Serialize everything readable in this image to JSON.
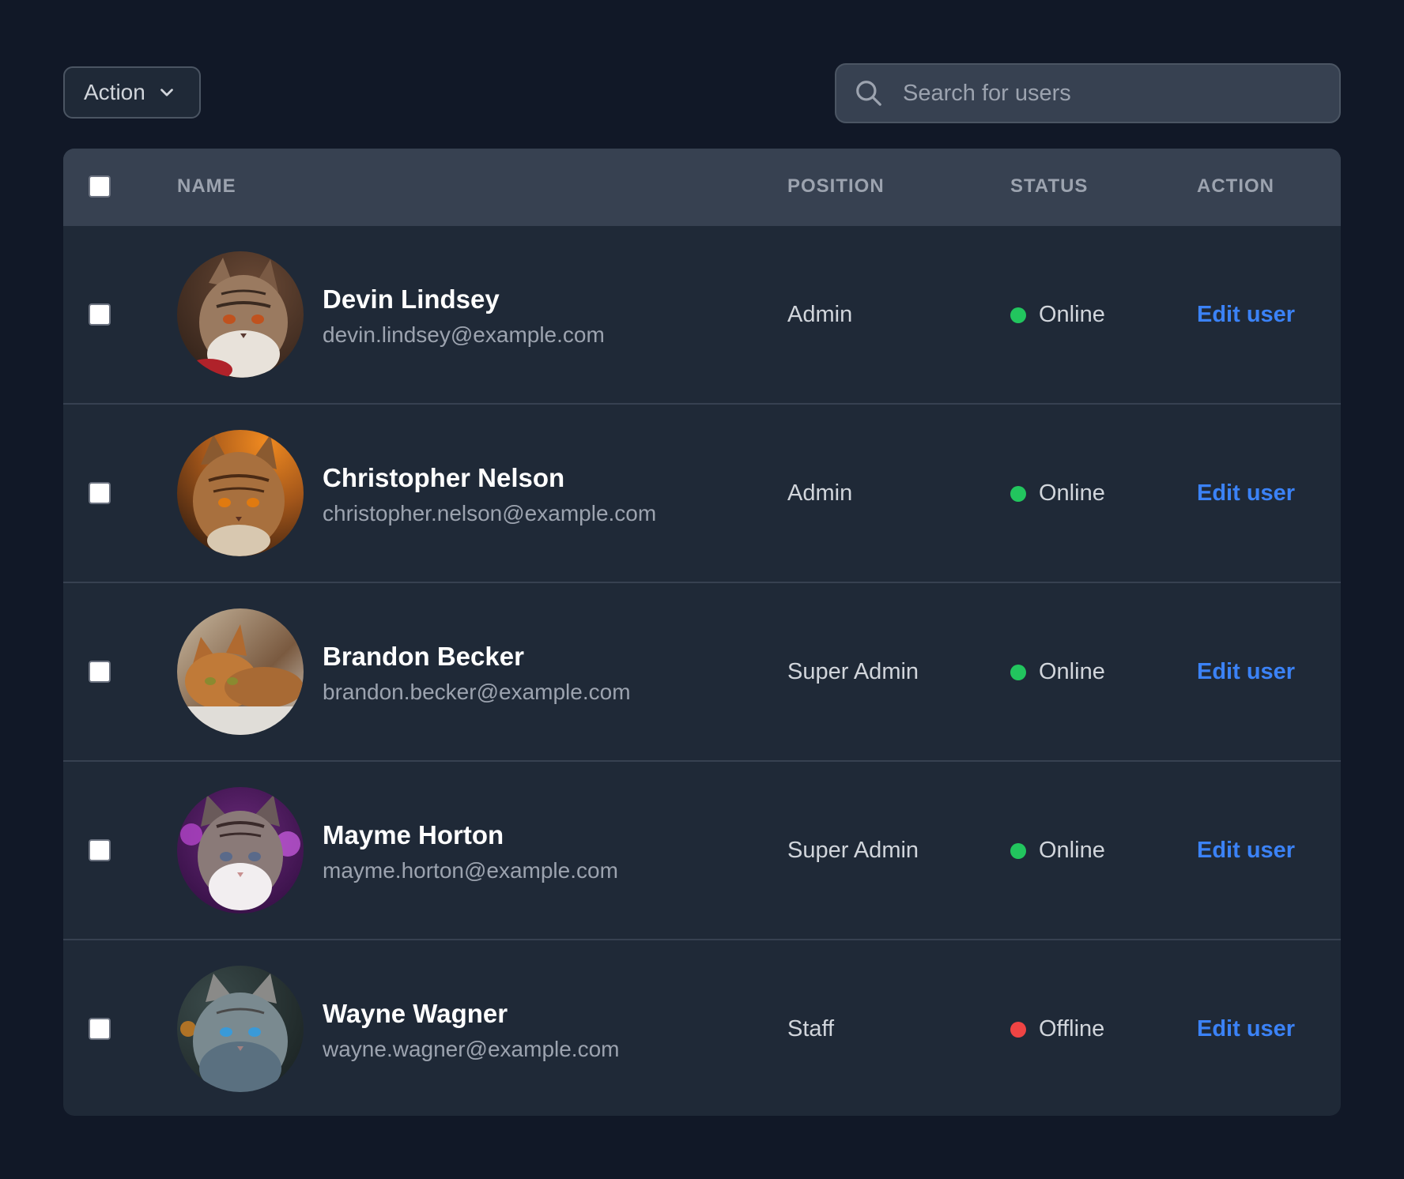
{
  "toolbar": {
    "action_label": "Action",
    "search_placeholder": "Search for users"
  },
  "table": {
    "headers": {
      "name": "NAME",
      "position": "POSITION",
      "status": "STATUS",
      "action": "ACTION"
    },
    "rows": [
      {
        "name": "Devin Lindsey",
        "email": "devin.lindsey@example.com",
        "position": "Admin",
        "status": "Online",
        "status_color": "#22c55e",
        "action": "Edit user"
      },
      {
        "name": "Christopher Nelson",
        "email": "christopher.nelson@example.com",
        "position": "Admin",
        "status": "Online",
        "status_color": "#22c55e",
        "action": "Edit user"
      },
      {
        "name": "Brandon Becker",
        "email": "brandon.becker@example.com",
        "position": "Super Admin",
        "status": "Online",
        "status_color": "#22c55e",
        "action": "Edit user"
      },
      {
        "name": "Mayme Horton",
        "email": "mayme.horton@example.com",
        "position": "Super Admin",
        "status": "Online",
        "status_color": "#22c55e",
        "action": "Edit user"
      },
      {
        "name": "Wayne Wagner",
        "email": "wayne.wagner@example.com",
        "position": "Staff",
        "status": "Offline",
        "status_color": "#ef4444",
        "action": "Edit user"
      }
    ]
  },
  "colors": {
    "page_background": "#111827",
    "table_background": "#1f2937",
    "header_background": "#374151",
    "link": "#3b82f6",
    "online": "#22c55e",
    "offline": "#ef4444"
  },
  "icons": {
    "dropdown": "chevron-down-icon",
    "search": "search-icon"
  }
}
